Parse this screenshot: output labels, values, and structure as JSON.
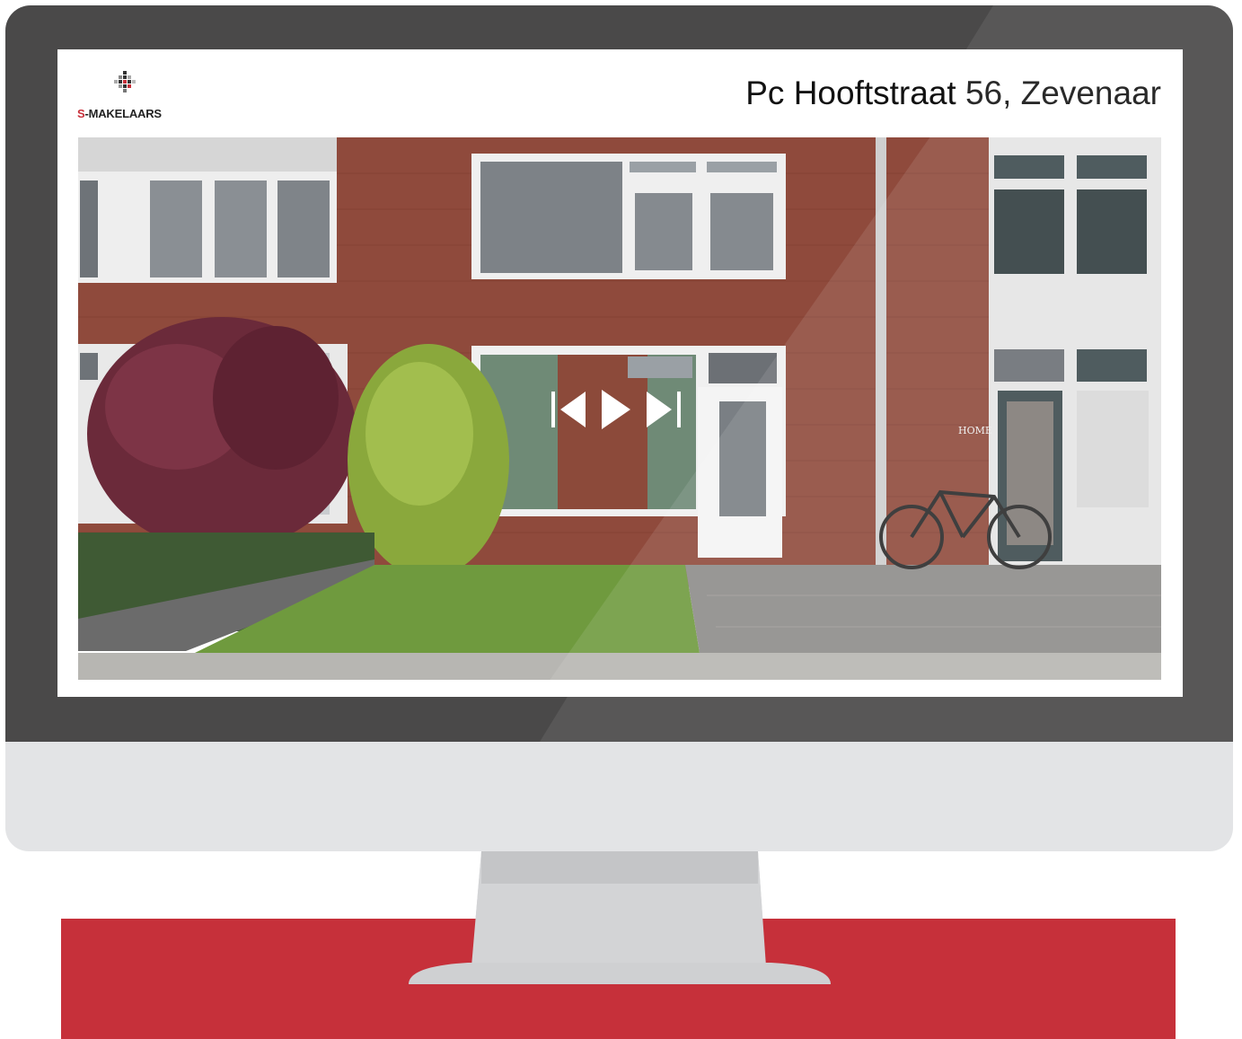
{
  "listing": {
    "brand": {
      "prefix": "S",
      "name": "-MAKELAARS"
    },
    "address": "Pc Hooftstraat 56, Zevenaar"
  },
  "photo": {
    "subject": "Front facade of terraced brick house with garden",
    "house_sign": "HOME"
  },
  "slideshow": {
    "controls": [
      "previous-icon",
      "play-icon",
      "next-icon"
    ]
  },
  "colors": {
    "bezel": "#4a4949",
    "chin": "#e3e4e6",
    "desk": "#c6303a",
    "brand_red": "#c8303a",
    "brick": "#8f4a3c"
  }
}
